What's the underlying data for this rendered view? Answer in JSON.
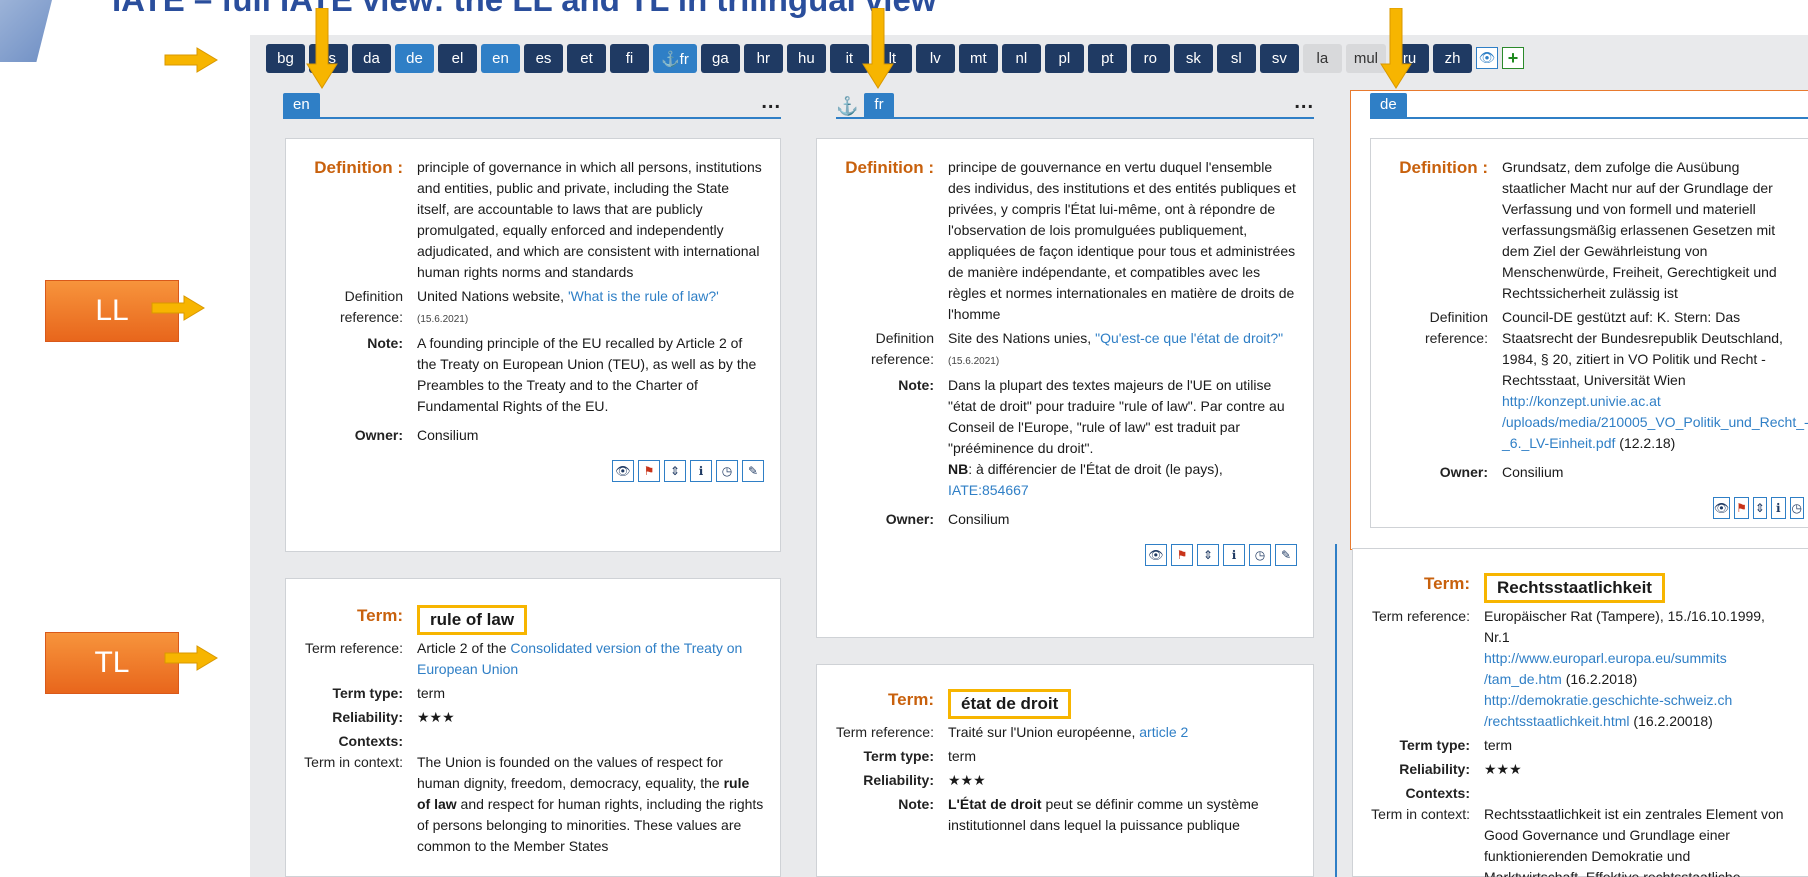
{
  "slide_title": "IATE – full IATE view: the LL and TL in trilingual view",
  "side_labels": {
    "ll": "LL",
    "tl": "TL"
  },
  "languages": [
    "bg",
    "cs",
    "da",
    "de",
    "el",
    "en",
    "es",
    "et",
    "fi",
    "⚓fr",
    "ga",
    "hr",
    "hu",
    "it",
    "lt",
    "lv",
    "mt",
    "nl",
    "pl",
    "pt",
    "ro",
    "sk",
    "sl",
    "sv",
    "la",
    "mul",
    "ru",
    "zh"
  ],
  "selected_languages": [
    "de",
    "en",
    "⚓fr"
  ],
  "muted_languages": [
    "la",
    "mul"
  ],
  "columns": {
    "en": {
      "tab": "en",
      "more": "...",
      "definition_label": "Definition :",
      "definition": "principle of governance in which all persons, institutions and entities, public and private, including the State itself, are accountable to laws that are publicly promulgated, equally enforced and independently adjudicated, and which are consistent with international human rights norms and standards",
      "def_ref_label": "Definition reference:",
      "def_ref_text": "United Nations website, ",
      "def_ref_link": "'What is the rule of law?'",
      "def_ref_date": "(15.6.2021)",
      "note_label": "Note:",
      "note": "A founding principle of the EU recalled by Article 2 of the Treaty on European Union (TEU), as well as by the Preambles to the Treaty and to the Charter of Fundamental Rights of the EU.",
      "owner_label": "Owner:",
      "owner": "Consilium",
      "term_label": "Term:",
      "term": "rule of law",
      "term_ref_label": "Term reference:",
      "term_ref_text": "Article 2 of the ",
      "term_ref_link": "Consolidated version of the Treaty on European Union",
      "term_type_label": "Term type:",
      "term_type": "term",
      "reliability_label": "Reliability:",
      "reliability": "★★★",
      "contexts_label": "Contexts:",
      "context_label": "Term in context:",
      "context_before": "The Union is founded on the values of respect for human dignity, freedom, democracy, equality, the ",
      "context_bold": "rule of law",
      "context_after": " and respect for human rights, including the rights of persons belonging to minorities. These values are common to the Member States"
    },
    "fr": {
      "tab": "fr",
      "anchor": "⚓",
      "more": "...",
      "definition_label": "Definition :",
      "definition": "principe de gouvernance en vertu duquel l'ensemble des individus, des institutions et des entités publiques et privées, y compris l'État lui-même, ont à répondre de l'observation de lois promulguées publiquement, appliquées de façon identique pour tous et administrées de manière indépendante, et compatibles avec les règles et normes internationales en matière de droits de l'homme",
      "def_ref_label": "Definition reference:",
      "def_ref_text": "Site des Nations unies, ",
      "def_ref_link": "\"Qu'est-ce que l'état de droit?\"",
      "def_ref_date": "(15.6.2021)",
      "note_label": "Note:",
      "note_1": "Dans la plupart des textes majeurs de l'UE on utilise \"état de droit\" pour traduire \"rule of law\". Par contre au Conseil de l'Europe, \"rule of law\" est traduit par \"prééminence du droit\".",
      "note_nb": "NB",
      "note_2": ": à différencier de l'État de droit (le pays),",
      "note_link": "IATE:854667",
      "owner_label": "Owner:",
      "owner": "Consilium",
      "term_label": "Term:",
      "term": "état de droit",
      "term_ref_label": "Term reference:",
      "term_ref_text": "Traité sur l'Union européenne, ",
      "term_ref_link": "article 2",
      "term_type_label": "Term type:",
      "term_type": "term",
      "reliability_label": "Reliability:",
      "reliability": "★★★",
      "note2_label": "Note:",
      "note2_bold": "L'État de droit",
      "note2_rest": " peut se définir comme un système institutionnel dans lequel la puissance publique"
    },
    "de": {
      "tab": "de",
      "definition_label": "Definition :",
      "definition": "Grundsatz, dem zufolge die Ausübung staatlicher Macht nur auf der Grundlage der Verfassung und von formell und materiell verfassungsmäßig erlassenen Gesetzen mit dem Ziel der Gewährleistung von Menschenwürde, Freiheit, Gerechtigkeit und Rechtssicherheit zulässig ist",
      "def_ref_label": "Definition reference:",
      "def_ref_text": "Council-DE gestützt auf: K. Stern: Das Staatsrecht der Bundesrepublik Deutschland, 1984, § 20, zitiert in VO Politik und Recht - Rechtsstaat, Universität Wien ",
      "def_ref_link": "http://konzept.univie.ac.at /uploads/media/210005_VO_Politik_und_Recht_-_6._LV-Einheit.pdf",
      "def_ref_date": "(12.2.18)",
      "owner_label": "Owner:",
      "owner": "Consilium",
      "term_label": "Term:",
      "term": "Rechtsstaatlichkeit",
      "term_ref_label": "Term reference:",
      "term_ref_text": "Europäischer Rat (Tampere), 15./16.10.1999, Nr.1",
      "term_ref_link1": "http://www.europarl.europa.eu/summits /tam_de.htm",
      "term_ref_date1": "(16.2.2018)",
      "term_ref_link2": "http://demokratie.geschichte-schweiz.ch /rechtsstaatlichkeit.html",
      "term_ref_date2": "(16.2.20018)",
      "term_type_label": "Term type:",
      "term_type": "term",
      "reliability_label": "Reliability:",
      "reliability": "★★★",
      "contexts_label": "Contexts:",
      "context_label": "Term in context:",
      "context": "Rechtsstaatlichkeit ist ein zentrales Element von Good Governance und Grundlage einer funktionierenden Demokratie und Marktwirtschaft. Effektive rechtsstaatliche"
    }
  },
  "action_icons": [
    "view-icon",
    "flag-icon",
    "split-icon",
    "info-icon",
    "history-icon",
    "edit-icon"
  ],
  "colors": {
    "accent": "#2f7fc6",
    "navy": "#1f3a63",
    "orange_label": "#c8610d",
    "highlight": "#f7b500",
    "arrow": "#f7b500"
  }
}
